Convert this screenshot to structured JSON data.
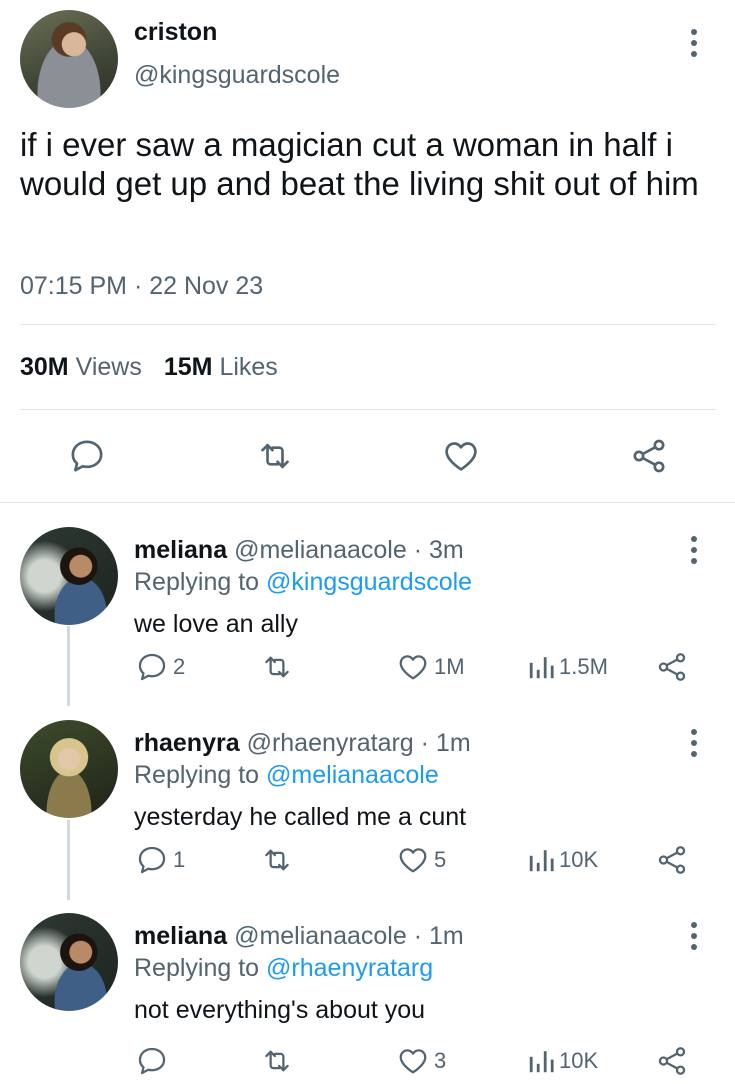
{
  "main_tweet": {
    "display_name": "criston",
    "handle": "@kingsguardscole",
    "text": "if i ever saw a magician cut a woman in half i would get up and beat the living shit out of him",
    "timestamp": "07:15 PM · 22 Nov 23",
    "views_count": "30M",
    "views_label": "Views",
    "likes_count": "15M",
    "likes_label": "Likes",
    "actions": [
      "reply-icon",
      "retweet-icon",
      "heart-icon",
      "share-icon"
    ]
  },
  "replies": [
    {
      "display_name": "meliana",
      "handle_time": "@melianaacole · 3m",
      "replying_prefix": "Replying to ",
      "replying_to": "@kingsguardscole",
      "text": "we love an ally",
      "reply_count": "2",
      "retweet_count": "",
      "like_count": "1M",
      "view_count": "1.5M"
    },
    {
      "display_name": "rhaenyra",
      "handle_time": "@rhaenyratarg · 1m",
      "replying_prefix": "Replying to ",
      "replying_to": "@melianaacole",
      "text": "yesterday he called me a cunt",
      "reply_count": "1",
      "retweet_count": "",
      "like_count": "5",
      "view_count": "10K"
    },
    {
      "display_name": "meliana",
      "handle_time": "@melianaacole · 1m",
      "replying_prefix": "Replying to ",
      "replying_to": "@rhaenyratarg",
      "text": "not everything's about you",
      "reply_count": "",
      "retweet_count": "",
      "like_count": "3",
      "view_count": "10K"
    }
  ],
  "colors": {
    "text": "#0f1419",
    "secondary": "#536471",
    "link": "#1d9bf0",
    "divider": "#e1e6e9"
  }
}
